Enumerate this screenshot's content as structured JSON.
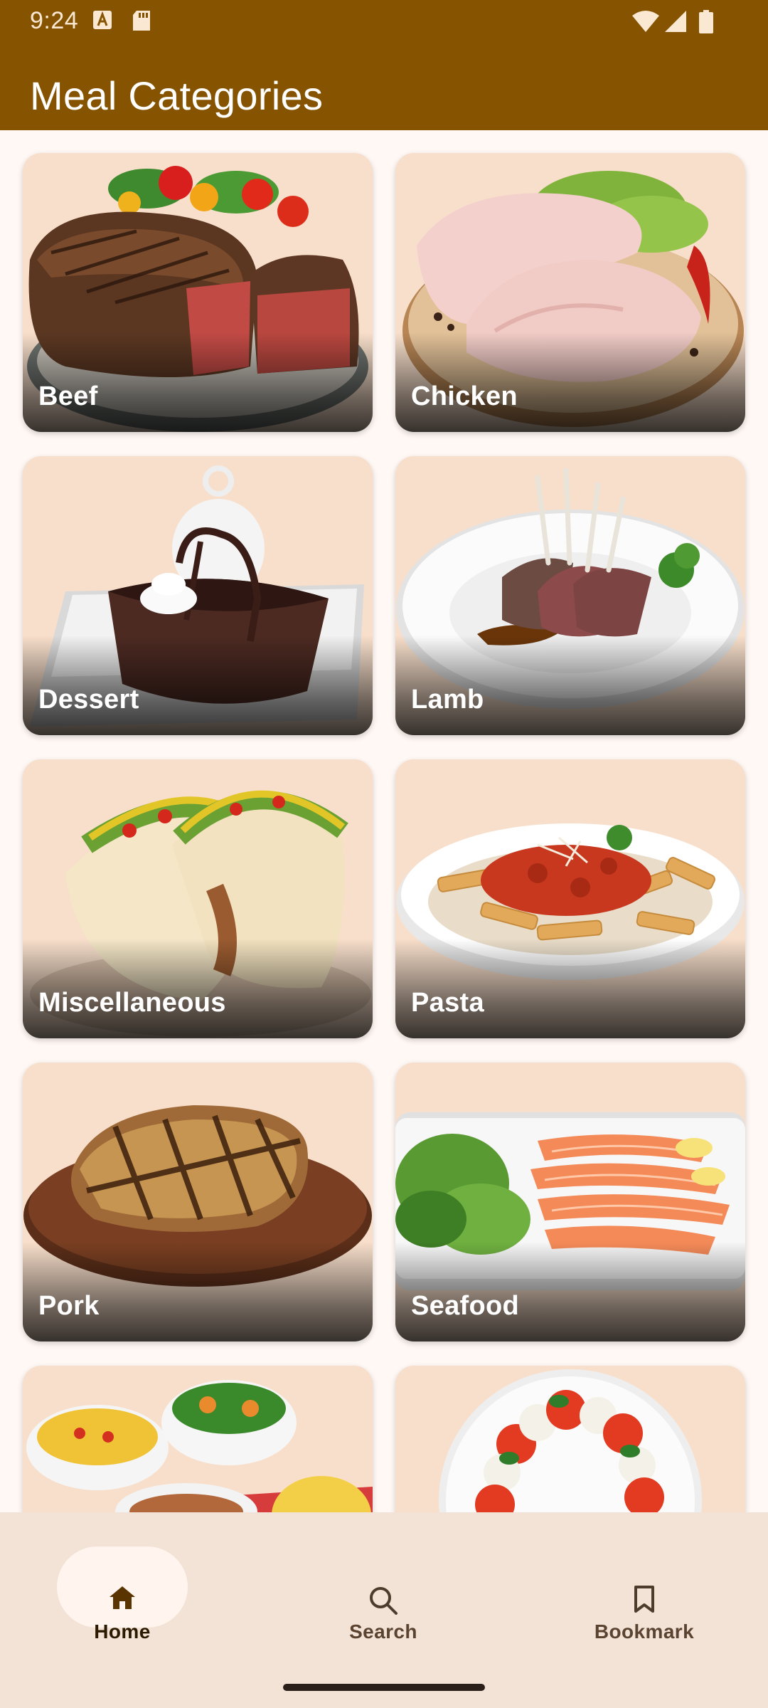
{
  "status_bar": {
    "time": "9:24",
    "left_icons": [
      "a-notification-icon",
      "sd-card-icon"
    ],
    "right_icons": [
      "wifi-icon",
      "signal-icon",
      "battery-icon"
    ]
  },
  "app_bar": {
    "title": "Meal Categories"
  },
  "categories": [
    {
      "label": "Beef"
    },
    {
      "label": "Chicken"
    },
    {
      "label": "Dessert"
    },
    {
      "label": "Lamb"
    },
    {
      "label": "Miscellaneous"
    },
    {
      "label": "Pasta"
    },
    {
      "label": "Pork"
    },
    {
      "label": "Seafood"
    },
    {
      "label": ""
    },
    {
      "label": ""
    }
  ],
  "bottom_nav": {
    "items": [
      {
        "label": "Home",
        "icon": "home-icon",
        "selected": true
      },
      {
        "label": "Search",
        "icon": "search-icon",
        "selected": false
      },
      {
        "label": "Bookmark",
        "icon": "bookmark-icon",
        "selected": false
      }
    ]
  },
  "colors": {
    "app_bar": "#865300",
    "background": "#fff8f4",
    "card_background": "#f8dfcb",
    "bottom_nav": "#f3e3d6",
    "nav_pill": "#fff4ee"
  }
}
